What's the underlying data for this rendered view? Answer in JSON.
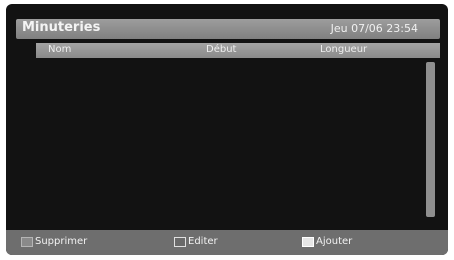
{
  "header": {
    "title": "Minuteries",
    "datetime": "Jeu 07/06 23:54"
  },
  "columns": {
    "name": "Nom",
    "start": "Début",
    "length": "Longueur"
  },
  "timers": [],
  "footer": {
    "delete_label": "Supprimer",
    "edit_label": "Editer",
    "add_label": "Ajouter"
  },
  "colors": {
    "background": "#121212",
    "header_bar": "#8f8f8f",
    "footer_bar": "#6e6e6e"
  },
  "icons": {
    "delete_key": "grey-key-icon",
    "edit_key": "dark-key-icon",
    "add_key": "white-key-icon"
  }
}
